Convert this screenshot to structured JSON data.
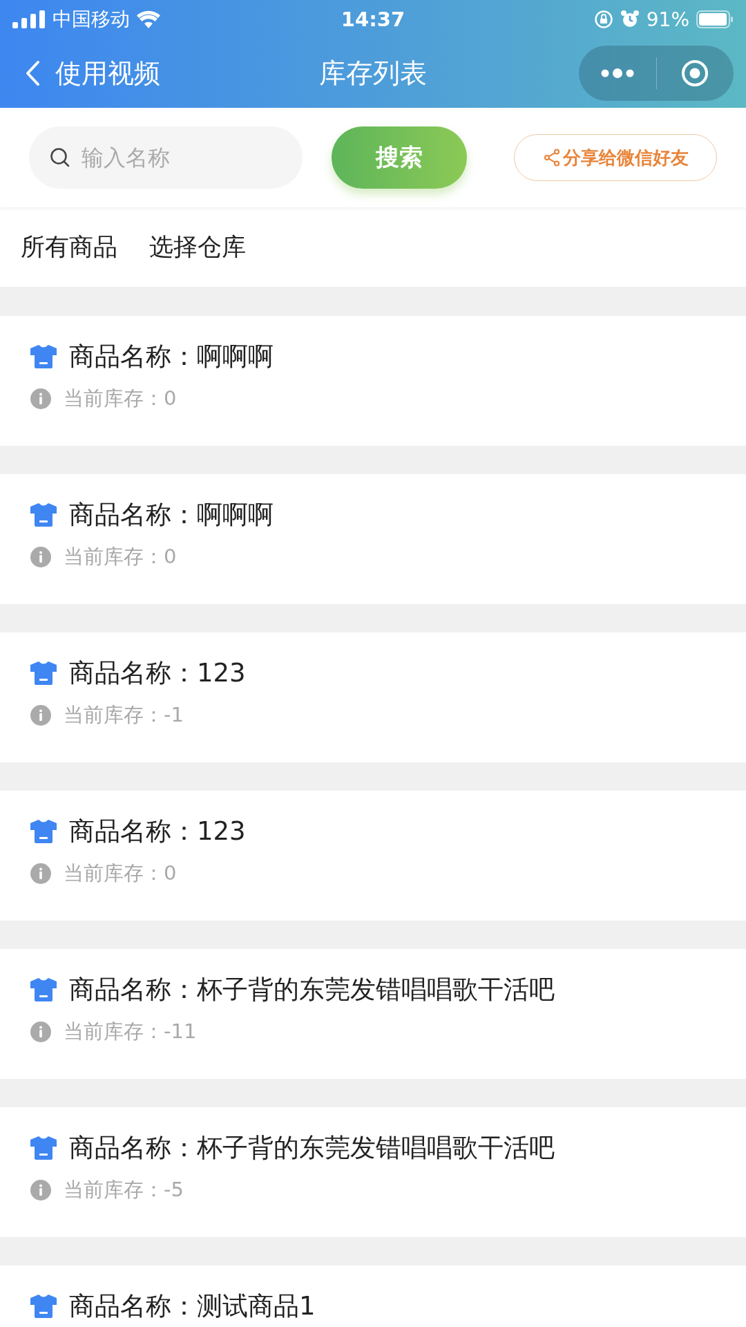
{
  "status_bar": {
    "carrier": "中国移动",
    "time": "14:37",
    "battery": "91%"
  },
  "nav_bar": {
    "back_label": "使用视频",
    "title": "库存列表"
  },
  "search": {
    "placeholder": "输入名称",
    "button": "搜索",
    "share_button": "分享给微信好友"
  },
  "filters": [
    "所有商品",
    "选择仓库"
  ],
  "items": [
    {
      "label": "商品名称：",
      "name": "啊啊啊",
      "stock": "当前库存：0"
    },
    {
      "label": "商品名称：",
      "name": "啊啊啊",
      "stock": "当前库存：0"
    },
    {
      "label": "商品名称：",
      "name": "123",
      "stock": "当前库存：-1"
    },
    {
      "label": "商品名称：",
      "name": "123",
      "stock": "当前库存：0"
    },
    {
      "label": "商品名称：",
      "name": "杯子背的东莞发错唱唱歌干活吧",
      "stock": "当前库存：-11"
    },
    {
      "label": "商品名称：",
      "name": "杯子背的东莞发错唱唱歌干活吧",
      "stock": "当前库存：-5"
    },
    {
      "label": "商品名称：",
      "name": "测试商品1"
    }
  ]
}
